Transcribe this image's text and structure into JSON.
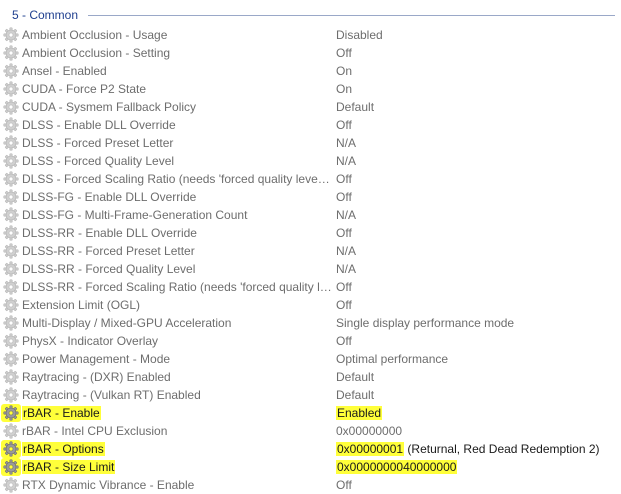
{
  "section": {
    "title": "5 - Common"
  },
  "rows": [
    {
      "name": "Ambient Occlusion  - Usage",
      "value": "Disabled"
    },
    {
      "name": "Ambient Occlusion - Setting",
      "value": "Off"
    },
    {
      "name": "Ansel - Enabled",
      "value": "On"
    },
    {
      "name": "CUDA - Force P2 State",
      "value": "On"
    },
    {
      "name": "CUDA - Sysmem Fallback Policy",
      "value": "Default"
    },
    {
      "name": "DLSS - Enable DLL Override",
      "value": "Off"
    },
    {
      "name": "DLSS - Forced Preset Letter",
      "value": "N/A"
    },
    {
      "name": "DLSS - Forced Quality Level",
      "value": "N/A"
    },
    {
      "name": "DLSS - Forced Scaling Ratio (needs 'forced quality level: custo...",
      "value": "Off"
    },
    {
      "name": "DLSS-FG - Enable DLL Override",
      "value": "Off"
    },
    {
      "name": "DLSS-FG - Multi-Frame-Generation Count",
      "value": "N/A"
    },
    {
      "name": "DLSS-RR - Enable DLL Override",
      "value": "Off"
    },
    {
      "name": "DLSS-RR - Forced Preset Letter",
      "value": "N/A"
    },
    {
      "name": "DLSS-RR - Forced Quality Level",
      "value": "N/A"
    },
    {
      "name": "DLSS-RR - Forced Scaling Ratio (needs 'forced quality level: c...",
      "value": "Off"
    },
    {
      "name": "Extension Limit (OGL)",
      "value": "Off"
    },
    {
      "name": "Multi-Display / Mixed-GPU Acceleration",
      "value": "Single display performance mode"
    },
    {
      "name": "PhysX - Indicator Overlay",
      "value": "Off"
    },
    {
      "name": "Power Management - Mode",
      "value": "Optimal performance"
    },
    {
      "name": "Raytracing - (DXR) Enabled",
      "value": "Default"
    },
    {
      "name": "Raytracing - (Vulkan RT) Enabled",
      "value": "Default"
    },
    {
      "name": "rBAR - Enable",
      "value": "Enabled",
      "highlight": true
    },
    {
      "name": "rBAR - Intel CPU Exclusion",
      "value": "0x00000000"
    },
    {
      "name": "rBAR - Options",
      "value": "0x00000001",
      "value_suffix": " (Returnal, Red Dead Redemption 2)",
      "highlight": true
    },
    {
      "name": "rBAR - Size Limit",
      "value": "0x0000000040000000",
      "highlight": true
    },
    {
      "name": "RTX Dynamic Vibrance - Enable",
      "value": "Off"
    }
  ],
  "colors": {
    "highlight": "#ffff3a",
    "header_text": "#1f3f8f",
    "row_text": "#6d6d6d"
  },
  "icons": {
    "row_icon": "gear-icon"
  }
}
